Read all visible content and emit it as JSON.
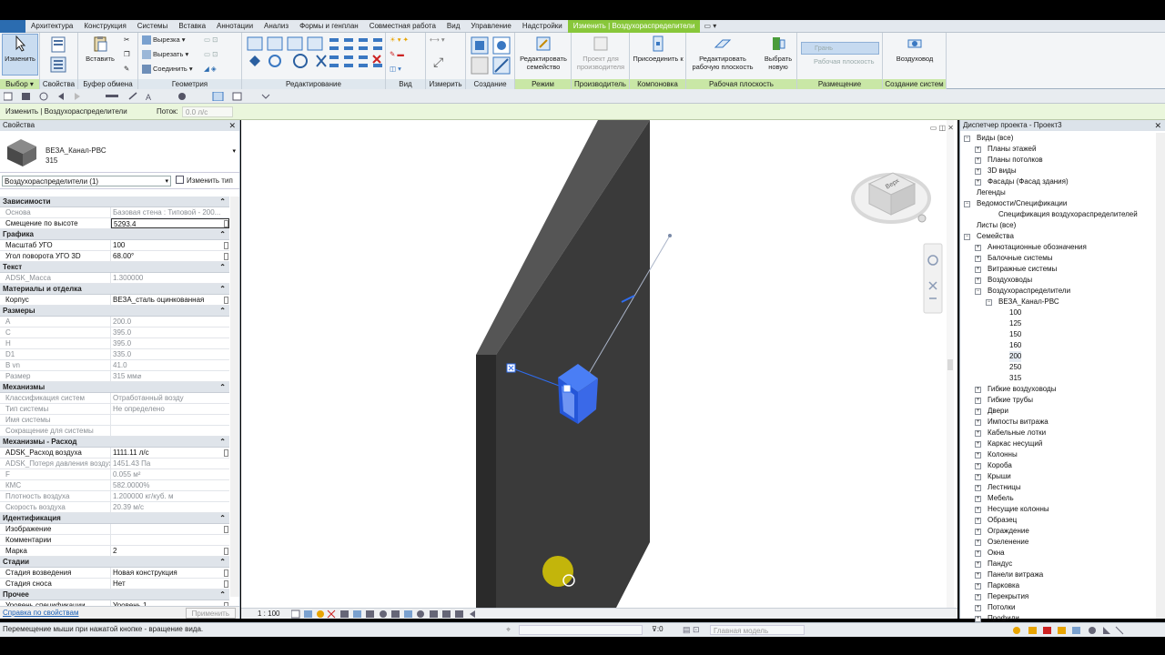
{
  "menu": {
    "tabs": [
      "Архитектура",
      "Конструкция",
      "Системы",
      "Вставка",
      "Аннотации",
      "Анализ",
      "Формы и генплан",
      "Совместная работа",
      "Вид",
      "Управление",
      "Надстройки",
      "Изменить | Воздухораспределители"
    ],
    "active_index": 11
  },
  "ribbon": {
    "select": {
      "modify": "Изменить",
      "label": "Выбор ▾"
    },
    "properties": {
      "label": "Свойства"
    },
    "clipboard": {
      "paste": "Вставить",
      "label": "Буфер обмена"
    },
    "geometry": {
      "cut": "Вырезка ▾",
      "uncut": "Вырезать ▾",
      "join": "Соединить ▾",
      "label": "Геометрия"
    },
    "edit": {
      "label": "Редактирование"
    },
    "view": {
      "label": "Вид"
    },
    "measure": {
      "label": "Измерить"
    },
    "create": {
      "label": "Создание"
    },
    "mode": {
      "edit_family": "Редактировать семейство",
      "label": "Режим"
    },
    "host": {
      "pick_host": "Проект для производителя",
      "label": "Производитель"
    },
    "layout": {
      "attach": "Присоединить к",
      "label": "Компоновка"
    },
    "work_plane": {
      "edit_wp": "Редактировать рабочую плоскость",
      "pick_new": "Выбрать новую",
      "label": "Рабочая плоскость"
    },
    "placement": {
      "face": "Грань",
      "work_plane": "Рабочая плоскость",
      "label": "Размещение"
    },
    "create_systems": {
      "duct": "Воздуховод",
      "label": "Создание систем"
    }
  },
  "options_bar": {
    "context": "Изменить | Воздухораспределители",
    "flow_label": "Поток:",
    "flow_value": "0.0 л/с"
  },
  "properties": {
    "title": "Свойства",
    "type_name": "ВЕЗА_Канал-РВС",
    "type_size": "315",
    "instance_filter": "Воздухораспределители (1)",
    "edit_type": "Изменить тип",
    "groups": [
      {
        "name": "Зависимости",
        "rows": [
          {
            "n": "Основа",
            "v": "Базовая стена : Типовой - 200...",
            "ro": true
          },
          {
            "n": "Смещение по высоте",
            "v": "5293.4",
            "edit": true
          }
        ]
      },
      {
        "name": "Графика",
        "rows": [
          {
            "n": "Масштаб УГО",
            "v": "100"
          },
          {
            "n": "Угол поворота УГО 3D",
            "v": "68.00°"
          }
        ]
      },
      {
        "name": "Текст",
        "rows": [
          {
            "n": "ADSK_Масса",
            "v": "1.300000",
            "ro": true
          }
        ]
      },
      {
        "name": "Материалы и отделка",
        "rows": [
          {
            "n": "Корпус",
            "v": "ВЕЗА_сталь оцинкованная"
          }
        ]
      },
      {
        "name": "Размеры",
        "rows": [
          {
            "n": "A",
            "v": "200.0",
            "ro": true
          },
          {
            "n": "C",
            "v": "395.0",
            "ro": true
          },
          {
            "n": "H",
            "v": "395.0",
            "ro": true
          },
          {
            "n": "D1",
            "v": "335.0",
            "ro": true
          },
          {
            "n": "B vn",
            "v": "41.0",
            "ro": true
          },
          {
            "n": "Размер",
            "v": "315 мм⌀",
            "ro": true
          }
        ]
      },
      {
        "name": "Механизмы",
        "rows": [
          {
            "n": "Классификация систем",
            "v": "Отработанный возду",
            "ro": true
          },
          {
            "n": "Тип системы",
            "v": "Не определено",
            "ro": true
          },
          {
            "n": "Имя системы",
            "v": "",
            "ro": true
          },
          {
            "n": "Сокращение для системы",
            "v": "",
            "ro": true
          }
        ]
      },
      {
        "name": "Механизмы - Расход",
        "rows": [
          {
            "n": "ADSK_Расход воздуха",
            "v": "1111.11 л/с"
          },
          {
            "n": "ADSK_Потеря давления воздуха",
            "v": "1451.43 Па",
            "ro": true
          },
          {
            "n": "F",
            "v": "0.055 м²",
            "ro": true
          },
          {
            "n": "КМС",
            "v": "582.0000%",
            "ro": true
          },
          {
            "n": "Плотность воздуха",
            "v": "1.200000 кг/куб. м",
            "ro": true
          },
          {
            "n": "Скорость воздуха",
            "v": "20.39 м/с",
            "ro": true
          }
        ]
      },
      {
        "name": "Идентификация",
        "rows": [
          {
            "n": "Изображение",
            "v": ""
          },
          {
            "n": "Комментарии",
            "v": ""
          },
          {
            "n": "Марка",
            "v": "2"
          }
        ]
      },
      {
        "name": "Стадии",
        "rows": [
          {
            "n": "Стадия возведения",
            "v": "Новая конструкция"
          },
          {
            "n": "Стадия сноса",
            "v": "Нет"
          }
        ]
      },
      {
        "name": "Прочее",
        "rows": [
          {
            "n": "Уровень спецификации",
            "v": "Уровень 1"
          }
        ]
      }
    ],
    "help_link": "Справка по свойствам",
    "apply": "Применить"
  },
  "viewport": {
    "scale": "1 : 100",
    "viewcube_face": "Верх"
  },
  "browser": {
    "title": "Диспетчер проекта - Проект3",
    "items": [
      {
        "t": "Виды (все)",
        "lvl": 0,
        "tg": "−"
      },
      {
        "t": "Планы этажей",
        "lvl": 1,
        "tg": "+"
      },
      {
        "t": "Планы потолков",
        "lvl": 1,
        "tg": "+"
      },
      {
        "t": "3D виды",
        "lvl": 1,
        "tg": "+"
      },
      {
        "t": "Фасады (Фасад здания)",
        "lvl": 1,
        "tg": "+"
      },
      {
        "t": "Легенды",
        "lvl": 0,
        "tg": ""
      },
      {
        "t": "Ведомости/Спецификации",
        "lvl": 0,
        "tg": "−"
      },
      {
        "t": "Спецификация воздухораспределителей",
        "lvl": 2,
        "tg": ""
      },
      {
        "t": "Листы (все)",
        "lvl": 0,
        "tg": ""
      },
      {
        "t": "Семейства",
        "lvl": 0,
        "tg": "−"
      },
      {
        "t": "Аннотационные обозначения",
        "lvl": 1,
        "tg": "+"
      },
      {
        "t": "Балочные системы",
        "lvl": 1,
        "tg": "+"
      },
      {
        "t": "Витражные системы",
        "lvl": 1,
        "tg": "+"
      },
      {
        "t": "Воздуховоды",
        "lvl": 1,
        "tg": "+"
      },
      {
        "t": "Воздухораспределители",
        "lvl": 1,
        "tg": "−"
      },
      {
        "t": "ВЕЗА_Канал-РВС",
        "lvl": 2,
        "tg": "−"
      },
      {
        "t": "100",
        "lvl": 3,
        "tg": ""
      },
      {
        "t": "125",
        "lvl": 3,
        "tg": ""
      },
      {
        "t": "150",
        "lvl": 3,
        "tg": ""
      },
      {
        "t": "160",
        "lvl": 3,
        "tg": ""
      },
      {
        "t": "200",
        "lvl": 3,
        "tg": "",
        "sel": true
      },
      {
        "t": "250",
        "lvl": 3,
        "tg": ""
      },
      {
        "t": "315",
        "lvl": 3,
        "tg": ""
      },
      {
        "t": "Гибкие воздуховоды",
        "lvl": 1,
        "tg": "+"
      },
      {
        "t": "Гибкие трубы",
        "lvl": 1,
        "tg": "+"
      },
      {
        "t": "Двери",
        "lvl": 1,
        "tg": "+"
      },
      {
        "t": "Импосты витража",
        "lvl": 1,
        "tg": "+"
      },
      {
        "t": "Кабельные лотки",
        "lvl": 1,
        "tg": "+"
      },
      {
        "t": "Каркас несущий",
        "lvl": 1,
        "tg": "+"
      },
      {
        "t": "Колонны",
        "lvl": 1,
        "tg": "+"
      },
      {
        "t": "Короба",
        "lvl": 1,
        "tg": "+"
      },
      {
        "t": "Крыши",
        "lvl": 1,
        "tg": "+"
      },
      {
        "t": "Лестницы",
        "lvl": 1,
        "tg": "+"
      },
      {
        "t": "Мебель",
        "lvl": 1,
        "tg": "+"
      },
      {
        "t": "Несущие колонны",
        "lvl": 1,
        "tg": "+"
      },
      {
        "t": "Образец",
        "lvl": 1,
        "tg": "+"
      },
      {
        "t": "Ограждение",
        "lvl": 1,
        "tg": "+"
      },
      {
        "t": "Озеленение",
        "lvl": 1,
        "tg": "+"
      },
      {
        "t": "Окна",
        "lvl": 1,
        "tg": "+"
      },
      {
        "t": "Пандус",
        "lvl": 1,
        "tg": "+"
      },
      {
        "t": "Панели витража",
        "lvl": 1,
        "tg": "+"
      },
      {
        "t": "Парковка",
        "lvl": 1,
        "tg": "+"
      },
      {
        "t": "Перекрытия",
        "lvl": 1,
        "tg": "+"
      },
      {
        "t": "Потолки",
        "lvl": 1,
        "tg": "+"
      },
      {
        "t": "Профили",
        "lvl": 1,
        "tg": "+"
      }
    ]
  },
  "status": {
    "message": "Перемещение мыши при нажатой кнопке - вращение вида.",
    "sel_count": ":0",
    "model": "Главная модель"
  },
  "colors": {
    "active_tab": "#88c73a",
    "wall": "#3a3a3a",
    "selection": "#2f6df0"
  }
}
